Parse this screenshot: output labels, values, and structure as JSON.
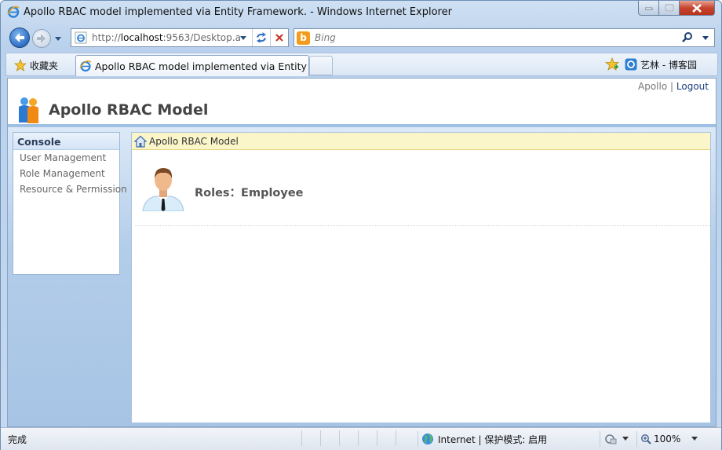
{
  "window": {
    "title": "Apollo RBAC model implemented via Entity Framework. - Windows Internet Explorer"
  },
  "address_bar": {
    "url_prefix": "http://",
    "url_host": "localhost",
    "url_rest": ":9563/Desktop.a"
  },
  "search": {
    "placeholder": "Bing"
  },
  "favorites": {
    "label": "收藏夹",
    "site_link": "艺林 - 博客园"
  },
  "tab": {
    "label": "Apollo RBAC model implemented via Entity F..."
  },
  "page": {
    "user_name": "Apollo",
    "separator": "|",
    "logout": "Logout",
    "app_title": "Apollo RBAC Model",
    "sidebar": {
      "heading": "Console",
      "items": [
        {
          "label": "User Management"
        },
        {
          "label": "Role Management"
        },
        {
          "label": "Resource & Permission"
        }
      ]
    },
    "breadcrumb": "Apollo RBAC Model",
    "roles_text": "Roles：Employee"
  },
  "status_bar": {
    "text": "完成",
    "zone": "Internet | 保护模式: 启用",
    "zoom": "100%"
  },
  "colors": {
    "accent": "#9ec0e4",
    "breadcrumb_bg": "#fbf6c9",
    "logout_link": "#1c3d7a"
  }
}
